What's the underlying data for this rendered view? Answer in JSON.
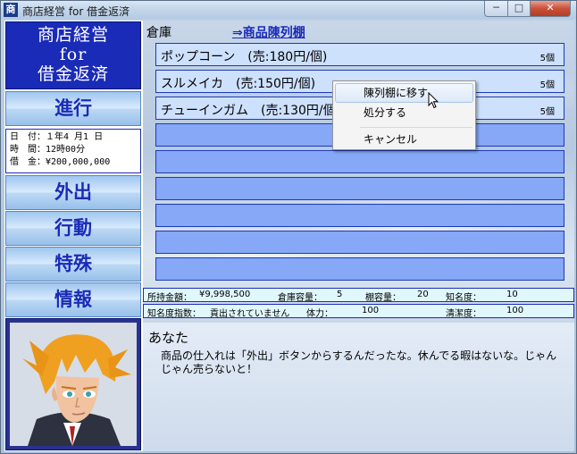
{
  "window": {
    "icon": "商",
    "title": "商店経営 for 借金返済",
    "minimize": "─",
    "maximize": "□",
    "close": "✕"
  },
  "sidebar": {
    "logo": [
      "商店経営",
      "for",
      "借金返済"
    ],
    "advance_label": "進行",
    "status_lines": [
      "日　付：１年4 月1 日",
      "時　間：12時00分",
      "借　金：¥200,000,000"
    ],
    "nav": [
      {
        "label": "外出"
      },
      {
        "label": "行動"
      },
      {
        "label": "特殊"
      },
      {
        "label": "情報"
      }
    ]
  },
  "warehouse": {
    "title": "倉庫",
    "link": "⇒商品陳列棚",
    "items": [
      {
        "name": "ポップコーン　(売:180円/個)",
        "qty": "5個"
      },
      {
        "name": "スルメイカ　(売:150円/個)",
        "qty": "5個"
      },
      {
        "name": "チューインガム　(売:130円/個)",
        "qty": "5個"
      }
    ]
  },
  "info1": {
    "money_label": "所持金額：",
    "money": "¥9,998,500",
    "cap_label": "倉庫容量：",
    "cap": "5",
    "shelf_label": "棚容量：",
    "shelf": "20",
    "fame_label": "知名度：",
    "fame": "10"
  },
  "info2": {
    "fame_idx_label": "知名度指数：",
    "fame_idx": "貢出されていません",
    "stamina_label": "体力：",
    "stamina": "100",
    "clean_label": "清潔度：",
    "clean": "100"
  },
  "dialog": {
    "speaker": "あなた",
    "message": "商品の仕入れは「外出」ボタンからするんだったな。休んでる暇はないな。じゃんじゃん売らないと！"
  },
  "context_menu": {
    "items": [
      "陳列棚に移す",
      "処分する",
      "キャンセル"
    ]
  }
}
